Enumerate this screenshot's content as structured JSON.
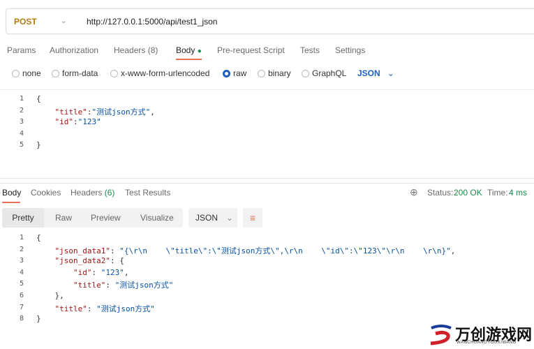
{
  "request": {
    "method": "POST",
    "url": "http://127.0.0.1:5000/api/test1_json",
    "tabs": [
      "Params",
      "Authorization",
      "Headers",
      "Body",
      "Pre-request Script",
      "Tests",
      "Settings"
    ],
    "headers_count": "(8)",
    "active_tab": "Body",
    "body_types": [
      "none",
      "form-data",
      "x-www-form-urlencoded",
      "raw",
      "binary",
      "GraphQL"
    ],
    "selected_body_type": "raw",
    "format": "JSON",
    "code": [
      {
        "n": "1",
        "parts": [
          [
            "p",
            "{"
          ]
        ]
      },
      {
        "n": "2",
        "parts": [
          [
            "p",
            "    "
          ],
          [
            "k",
            "\"title\""
          ],
          [
            "p",
            ":"
          ],
          [
            "s",
            "\"测试json方式\""
          ],
          [
            "p",
            ","
          ]
        ]
      },
      {
        "n": "3",
        "parts": [
          [
            "p",
            "    "
          ],
          [
            "k",
            "\"id\""
          ],
          [
            "p",
            ":"
          ],
          [
            "s",
            "\"123\""
          ]
        ]
      },
      {
        "n": "4",
        "parts": [
          [
            "p",
            ""
          ]
        ]
      },
      {
        "n": "5",
        "parts": [
          [
            "p",
            "}"
          ]
        ]
      }
    ]
  },
  "response": {
    "tabs": [
      "Body",
      "Cookies",
      "Headers",
      "Test Results"
    ],
    "headers_count": "(6)",
    "status_label": "Status:",
    "status": "200 OK",
    "time_label": "Time:",
    "time": "4 ms",
    "views": [
      "Pretty",
      "Raw",
      "Preview",
      "Visualize"
    ],
    "active_view": "Pretty",
    "format": "JSON",
    "code": [
      {
        "n": "1",
        "parts": [
          [
            "p",
            "{"
          ]
        ]
      },
      {
        "n": "2",
        "parts": [
          [
            "p",
            "    "
          ],
          [
            "k",
            "\"json_data1\""
          ],
          [
            "p",
            ": "
          ],
          [
            "s",
            "\"{\\r\\n    \\\"title\\\":\\\"测试json方式\\\",\\r\\n    \\\"id\\\":\\\"123\\\"\\r\\n    \\r\\n}\""
          ],
          [
            "p",
            ","
          ]
        ]
      },
      {
        "n": "3",
        "parts": [
          [
            "p",
            "    "
          ],
          [
            "k",
            "\"json_data2\""
          ],
          [
            "p",
            ": {"
          ]
        ]
      },
      {
        "n": "4",
        "parts": [
          [
            "p",
            "        "
          ],
          [
            "k",
            "\"id\""
          ],
          [
            "p",
            ": "
          ],
          [
            "s",
            "\"123\""
          ],
          [
            "p",
            ","
          ]
        ]
      },
      {
        "n": "5",
        "parts": [
          [
            "p",
            "        "
          ],
          [
            "k",
            "\"title\""
          ],
          [
            "p",
            ": "
          ],
          [
            "s",
            "\"测试json方式\""
          ]
        ]
      },
      {
        "n": "6",
        "parts": [
          [
            "p",
            "    },"
          ]
        ]
      },
      {
        "n": "7",
        "parts": [
          [
            "p",
            "    "
          ],
          [
            "k",
            "\"title\""
          ],
          [
            "p",
            ": "
          ],
          [
            "s",
            "\"测试json方式\""
          ]
        ]
      },
      {
        "n": "8",
        "parts": [
          [
            "p",
            "}"
          ]
        ]
      }
    ]
  },
  "watermark": {
    "title": "万创游戏网",
    "subtitle": "WANCHUANGYOUXIWANG"
  },
  "colors": {
    "accent": "#e8735a",
    "method": "#b07d10",
    "json_blue": "#1f5fbf",
    "ok_green": "#1a8a4a"
  }
}
